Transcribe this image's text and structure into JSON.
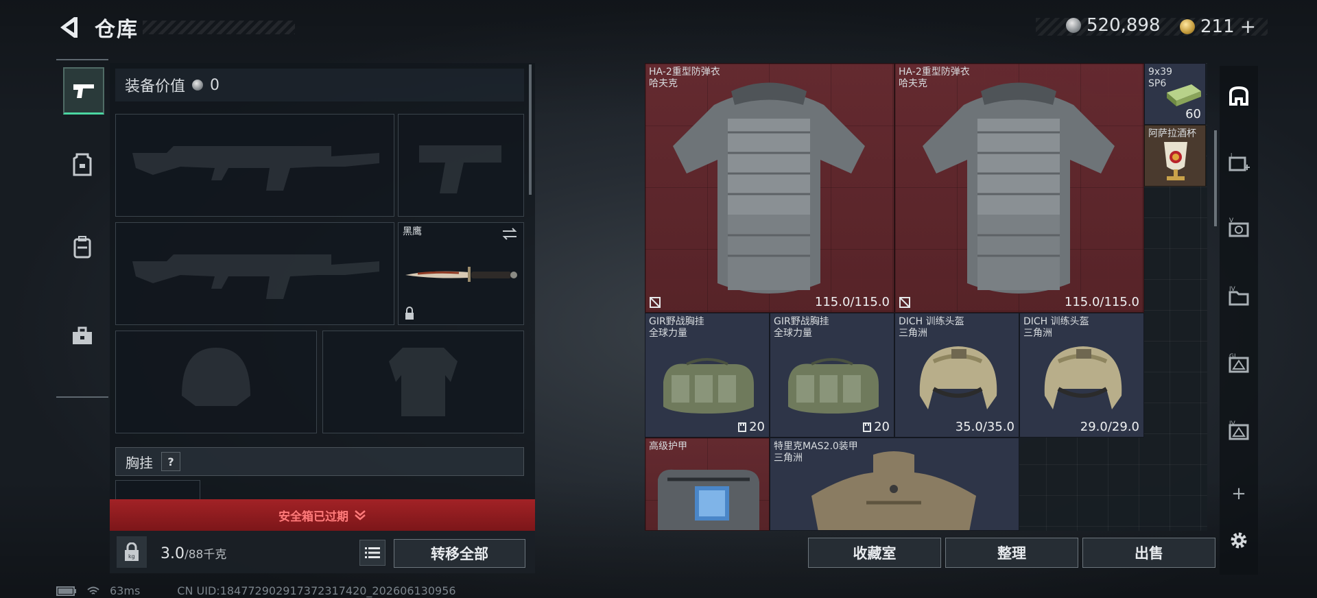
{
  "header": {
    "title": "仓库"
  },
  "currency": {
    "silver": "520,898",
    "gold": "211",
    "gold_plus": "+"
  },
  "left_nav": [
    "weapon-tab",
    "armor-tab",
    "backpack-tab",
    "toolbox-tab"
  ],
  "loadout": {
    "equip_value_label": "装备价值",
    "equip_value": "0",
    "melee_name": "黑鹰",
    "chest_rig_label": "胸挂",
    "chest_help": "?",
    "warning": "安全箱已过期",
    "weight_current": "3.0",
    "weight_max": "/88千克",
    "transfer_all": "转移全部"
  },
  "stash": {
    "items": [
      {
        "name": "HA-2重型防弹衣",
        "sub": "哈夫克",
        "dur": "115.0/115.0"
      },
      {
        "name": "HA-2重型防弹衣",
        "sub": "哈夫克",
        "dur": "115.0/115.0"
      },
      {
        "name": "9x39",
        "sub": "SP6",
        "count": "60"
      },
      {
        "name": "阿萨拉酒杯"
      },
      {
        "name": "GIR野战胸挂",
        "sub": "全球力量",
        "count": "20"
      },
      {
        "name": "GIR野战胸挂",
        "sub": "全球力量",
        "count": "20"
      },
      {
        "name": "DICH 训练头盔",
        "sub": "三角洲",
        "dur": "35.0/35.0"
      },
      {
        "name": "DICH 训练头盔",
        "sub": "三角洲",
        "dur": "29.0/29.0"
      },
      {
        "name": "高级护甲"
      },
      {
        "name": "特里克MAS2.0装甲",
        "sub": "三角洲"
      }
    ],
    "buttons": {
      "collection": "收藏室",
      "sort": "整理",
      "sell": "出售"
    }
  },
  "right_tabs": [
    "main-stash-tab",
    "I",
    "V",
    "IV",
    "GI",
    "IV"
  ],
  "status_bar": {
    "ping": "63ms",
    "uid": "CN UID:184772902917372317420_202606130956"
  },
  "colors": {
    "accent_green": "#4bd7a2",
    "warning_red": "#a22226",
    "cell_red": "#5a2328",
    "cell_blue": "#2e3548"
  }
}
